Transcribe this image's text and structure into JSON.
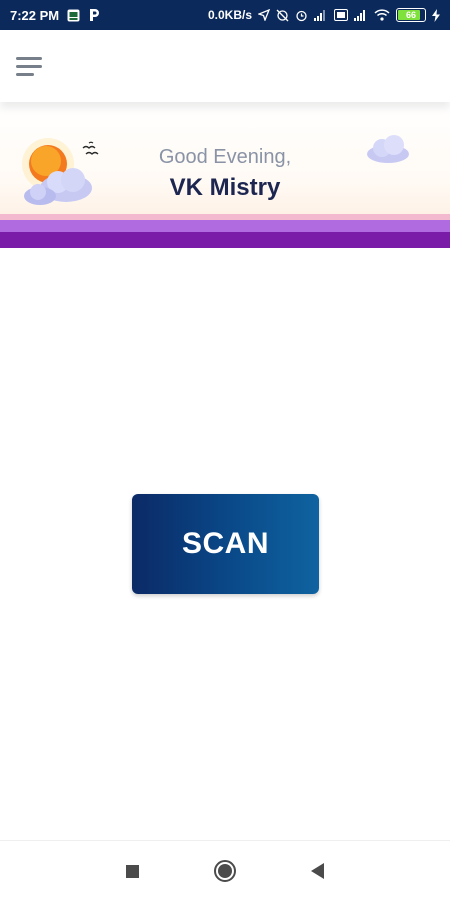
{
  "status_bar": {
    "time": "7:22 PM",
    "network_speed": "0.0KB/s",
    "battery_level": "66",
    "icons_left": [
      "gallery-icon",
      "parking-icon"
    ],
    "icons_right": [
      "location-arrow-icon",
      "no-sync-icon",
      "alarm-icon",
      "signal-icon",
      "volte-icon",
      "signal-icon",
      "wifi-icon",
      "battery-icon",
      "charging-icon"
    ]
  },
  "app_bar": {
    "menu_icon": "hamburger-menu-icon"
  },
  "banner": {
    "greeting": "Good Evening,",
    "user_name": "VK Mistry",
    "colors": {
      "stripe_light": "#f2b9cf",
      "stripe_mid": "#b06be0",
      "stripe_dark": "#7b1ca8"
    }
  },
  "main": {
    "scan_label": "SCAN",
    "scan_color_start": "#0b2a66",
    "scan_color_end": "#0f63a0"
  },
  "nav_bar": {
    "items": [
      "recents-icon",
      "home-icon",
      "back-icon"
    ]
  }
}
